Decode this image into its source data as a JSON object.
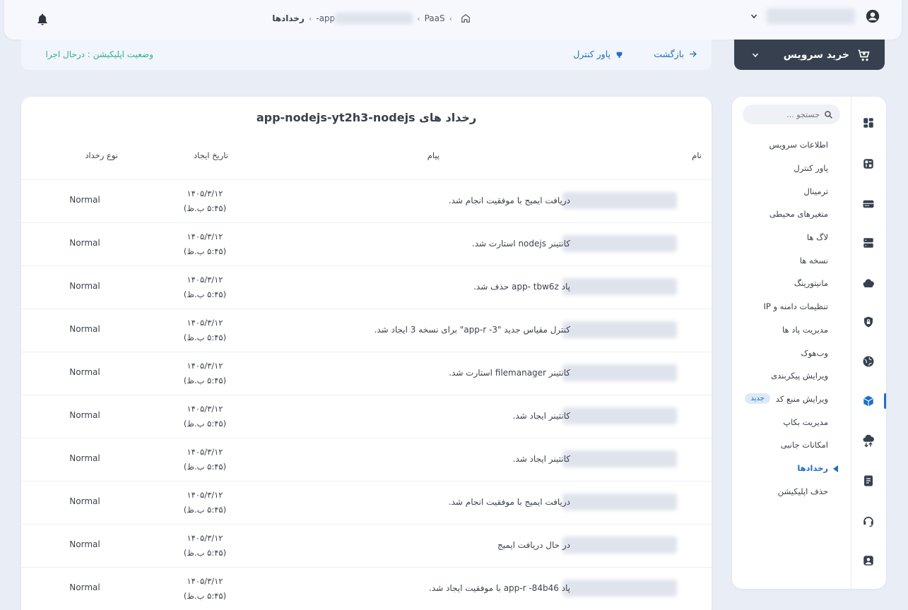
{
  "header": {
    "breadcrumb": {
      "current": "رخدادها",
      "app_prefix": "app-",
      "paas": "PaaS"
    }
  },
  "status_bar": {
    "status": "وضعیت اپلیکیشن : درحال اجرا",
    "back_label": "بازگشت",
    "power_label": "پاور کنترل"
  },
  "buy": {
    "label": "خرید سرویس"
  },
  "main": {
    "title": "رخداد های app-nodejs-yt2h3-nodejs",
    "columns": {
      "name": "نام",
      "message": "پیام",
      "created": "تاریخ ایجاد",
      "type": "نوع رخداد"
    },
    "rows": [
      {
        "message": "دریافت ایمیج با موفقیت انجام شد.",
        "date": "۱۴۰۵/۳/۱۲",
        "time": "(۵:۴۵ ب.ظ)",
        "type": "Normal"
      },
      {
        "message": "کانتینر nodejs استارت شد.",
        "date": "۱۴۰۵/۳/۱۲",
        "time": "(۵:۴۵ ب.ظ)",
        "type": "Normal"
      },
      {
        "message": "پاد app-                         tbw6z حذف شد.",
        "date": "۱۴۰۵/۳/۱۲",
        "time": "(۵:۴۵ ب.ظ)",
        "type": "Normal"
      },
      {
        "message": "کنترل مقیاس جدید \"3-                    app-r\" برای نسخه 3 ایجاد شد.",
        "date": "۱۴۰۵/۳/۱۲",
        "time": "(۵:۴۵ ب.ظ)",
        "type": "Normal"
      },
      {
        "message": "کانتینر filemanager استارت شد.",
        "date": "۱۴۰۵/۳/۱۲",
        "time": "(۵:۴۵ ب.ظ)",
        "type": "Normal"
      },
      {
        "message": "کانتینر ایجاد شد.",
        "date": "۱۴۰۵/۳/۱۲",
        "time": "(۵:۴۵ ب.ظ)",
        "type": "Normal"
      },
      {
        "message": "کانتینر ایجاد شد.",
        "date": "۱۴۰۵/۳/۱۲",
        "time": "(۵:۴۵ ب.ظ)",
        "type": "Normal"
      },
      {
        "message": "دریافت ایمیج با موفقیت انجام شد.",
        "date": "۱۴۰۵/۳/۱۲",
        "time": "(۵:۴۵ ب.ظ)",
        "type": "Normal"
      },
      {
        "message": "در حال دریافت ایمیج",
        "date": "۱۴۰۵/۳/۱۲",
        "time": "(۵:۴۵ ب.ظ)",
        "type": "Normal"
      },
      {
        "message": "پاد app-r                    -84b46 با موفقیت ایجاد شد.",
        "date": "۱۴۰۵/۳/۱۲",
        "time": "(۵:۴۵ ب.ظ)",
        "type": "Normal"
      }
    ]
  },
  "sidebar": {
    "search_placeholder": "جستجو ...",
    "new_badge": "جدید",
    "items": [
      {
        "label": "اطلاعات سرویس"
      },
      {
        "label": "پاور کنترل"
      },
      {
        "label": "ترمینال"
      },
      {
        "label": "متغیرهای محیطی"
      },
      {
        "label": "لاگ ها"
      },
      {
        "label": "نسخه ها"
      },
      {
        "label": "مانیتورینگ"
      },
      {
        "label": "تنظیمات دامنه و IP"
      },
      {
        "label": "مدیریت پاد ها"
      },
      {
        "label": "وب‌هوک"
      },
      {
        "label": "ویرایش پیکربندی"
      },
      {
        "label": "ویرایش منبع کد"
      },
      {
        "label": "مدیریت بکاپ"
      },
      {
        "label": "امکانات جانبی"
      },
      {
        "label": "رخدادها"
      },
      {
        "label": "حذف اپلیکیشن"
      }
    ],
    "icons": [
      "dashboard-icon",
      "apps-icon",
      "storage-icon",
      "server-icon",
      "cloud-drive-icon",
      "shield-lock-icon",
      "globe-icon",
      "cube-icon",
      "cloud-transfer-icon",
      "document-icon",
      "headset-icon",
      "account-icon"
    ],
    "active_color": "#1e6fc4"
  },
  "colors": {
    "accent": "#1e6fc4",
    "status_green": "#2fb18e",
    "buy_bg": "#37404f"
  }
}
